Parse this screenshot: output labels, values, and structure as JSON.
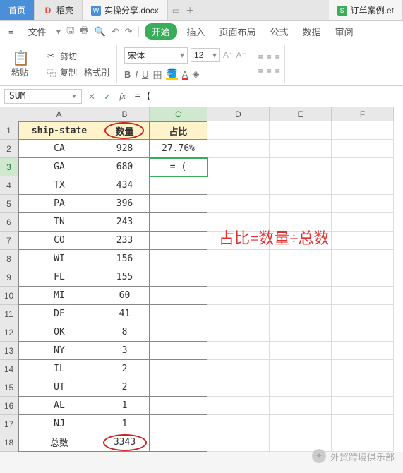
{
  "tabs": [
    {
      "label": "首页",
      "icon_color": "#fff",
      "active": true
    },
    {
      "label": "稻壳",
      "icon_color": "#e74c3c"
    },
    {
      "label": "实操分享.docx",
      "icon_color": "#4a8fd8"
    },
    {
      "label": "订单案例.et",
      "icon_color": "#3aad5a"
    }
  ],
  "menu": {
    "file": "文件",
    "start": "开始",
    "insert": "插入",
    "layout": "页面布局",
    "formula": "公式",
    "data": "数据",
    "review": "审阅"
  },
  "ribbon": {
    "paste": "粘贴",
    "cut": "剪切",
    "copy": "复制",
    "format_painter": "格式刷",
    "font_name": "宋体",
    "font_size": "12"
  },
  "fbar": {
    "name": "SUM",
    "formula": "= ("
  },
  "columns": [
    "A",
    "B",
    "C",
    "D",
    "E",
    "F"
  ],
  "headers": {
    "A": "ship-state",
    "B": "数量",
    "C": "占比"
  },
  "rows": [
    {
      "n": "1"
    },
    {
      "n": "2",
      "A": "CA",
      "B": "928",
      "C": "27.76%"
    },
    {
      "n": "3",
      "A": "GA",
      "B": "680",
      "C": "= ("
    },
    {
      "n": "4",
      "A": "TX",
      "B": "434",
      "C": ""
    },
    {
      "n": "5",
      "A": "PA",
      "B": "396",
      "C": ""
    },
    {
      "n": "6",
      "A": "TN",
      "B": "243",
      "C": ""
    },
    {
      "n": "7",
      "A": "CO",
      "B": "233",
      "C": ""
    },
    {
      "n": "8",
      "A": "WI",
      "B": "156",
      "C": ""
    },
    {
      "n": "9",
      "A": "FL",
      "B": "155",
      "C": ""
    },
    {
      "n": "10",
      "A": "MI",
      "B": "60",
      "C": ""
    },
    {
      "n": "11",
      "A": "DF",
      "B": "41",
      "C": ""
    },
    {
      "n": "12",
      "A": "OK",
      "B": "8",
      "C": ""
    },
    {
      "n": "13",
      "A": "NY",
      "B": "3",
      "C": ""
    },
    {
      "n": "14",
      "A": "IL",
      "B": "2",
      "C": ""
    },
    {
      "n": "15",
      "A": "UT",
      "B": "2",
      "C": ""
    },
    {
      "n": "16",
      "A": "AL",
      "B": "1",
      "C": ""
    },
    {
      "n": "17",
      "A": "NJ",
      "B": "1",
      "C": ""
    },
    {
      "n": "18",
      "A": "总数",
      "B": "3343",
      "C": ""
    }
  ],
  "active_cell": "C3",
  "annotation": "占比=数量÷总数",
  "watermark": "外贸跨境俱乐部"
}
